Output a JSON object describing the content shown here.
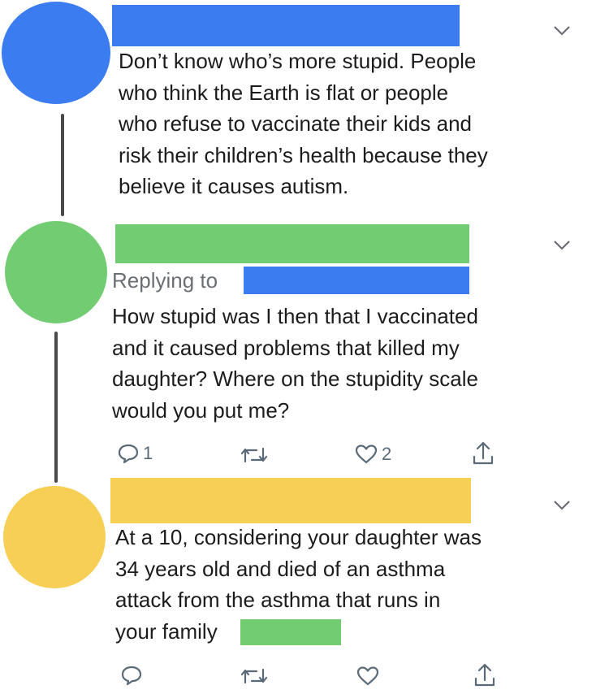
{
  "colors": {
    "blue": "#3b7cf0",
    "green": "#72cd72",
    "yellow": "#f7cf55",
    "thread_line": "#4a4a4a",
    "icon_gray": "#5b6a78"
  },
  "tweets": [
    {
      "avatar_color": "blue",
      "text": "Don’t know who’s more stupid. People\nwho think the Earth is flat or people\nwho refuse to vaccinate their kids and\nrisk their children’s health because they\nbelieve it causes autism."
    },
    {
      "avatar_color": "green",
      "replying_label": "Replying to",
      "text": "How stupid was I then that I vaccinated\nand it caused problems that killed my\ndaughter? Where on the stupidity scale\nwould you put me?",
      "actions": {
        "reply_icon": "comment-icon",
        "reply_count": "1",
        "retweet_icon": "retweet-icon",
        "like_icon": "heart-icon",
        "like_count": "2",
        "share_icon": "share-icon"
      }
    },
    {
      "avatar_color": "yellow",
      "text": "At a 10, considering your daughter was\n34 years old and died of an asthma\nattack from the asthma that runs in\nyour family",
      "actions": {
        "reply_icon": "comment-icon",
        "retweet_icon": "retweet-icon",
        "like_icon": "heart-icon",
        "share_icon": "share-icon"
      }
    }
  ]
}
